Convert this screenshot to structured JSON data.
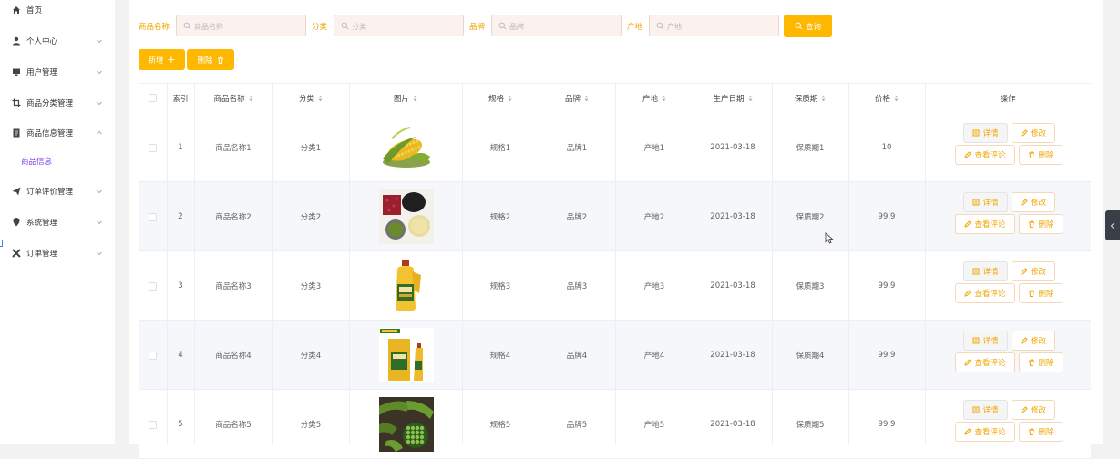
{
  "sidebar": {
    "items": [
      {
        "label": "首页",
        "icon": "home-icon",
        "has_arrow": false,
        "expanded": false
      },
      {
        "label": "个人中心",
        "icon": "user-icon",
        "has_arrow": true,
        "expanded": false
      },
      {
        "label": "用户管理",
        "icon": "monitor-icon",
        "has_arrow": true,
        "expanded": false
      },
      {
        "label": "商品分类管理",
        "icon": "crop-icon",
        "has_arrow": true,
        "expanded": false
      },
      {
        "label": "商品信息管理",
        "icon": "document-icon",
        "has_arrow": true,
        "expanded": true
      },
      {
        "label": "订单评价管理",
        "icon": "paper-plane-icon",
        "has_arrow": true,
        "expanded": false
      },
      {
        "label": "系统管理",
        "icon": "location-pin-icon",
        "has_arrow": true,
        "expanded": false
      },
      {
        "label": "订单管理",
        "icon": "tools-icon",
        "has_arrow": true,
        "expanded": false
      }
    ],
    "subitem": {
      "label": "商品信息"
    }
  },
  "search": {
    "fields": [
      {
        "label": "商品名称",
        "placeholder": "商品名称"
      },
      {
        "label": "分类",
        "placeholder": "分类"
      },
      {
        "label": "品牌",
        "placeholder": "品牌"
      },
      {
        "label": "产地",
        "placeholder": "产地"
      }
    ],
    "query_label": "查询"
  },
  "actions": {
    "add_label": "新增",
    "delete_label": "删除"
  },
  "table": {
    "columns": [
      "索引",
      "商品名称",
      "分类",
      "图片",
      "规格",
      "品牌",
      "产地",
      "生产日期",
      "保质期",
      "价格",
      "操作"
    ],
    "rows": [
      {
        "index": "1",
        "name": "商品名称1",
        "category": "分类1",
        "image": "corn",
        "spec": "规格1",
        "brand": "品牌1",
        "origin": "产地1",
        "date": "2021-03-18",
        "shelf": "保质期1",
        "price": "10"
      },
      {
        "index": "2",
        "name": "商品名称2",
        "category": "分类2",
        "image": "grains",
        "spec": "规格2",
        "brand": "品牌2",
        "origin": "产地2",
        "date": "2021-03-18",
        "shelf": "保质期2",
        "price": "99.9"
      },
      {
        "index": "3",
        "name": "商品名称3",
        "category": "分类3",
        "image": "oil-bottle",
        "spec": "规格3",
        "brand": "品牌3",
        "origin": "产地3",
        "date": "2021-03-18",
        "shelf": "保质期3",
        "price": "99.9"
      },
      {
        "index": "4",
        "name": "商品名称4",
        "category": "分类4",
        "image": "oil-set",
        "spec": "规格4",
        "brand": "品牌4",
        "origin": "产地4",
        "date": "2021-03-18",
        "shelf": "保质期4",
        "price": "99.9"
      },
      {
        "index": "5",
        "name": "商品名称5",
        "category": "分类5",
        "image": "peas",
        "spec": "规格5",
        "brand": "品牌5",
        "origin": "产地5",
        "date": "2021-03-18",
        "shelf": "保质期5",
        "price": "99.9"
      }
    ],
    "row_actions": {
      "detail": "详情",
      "edit": "修改",
      "review": "查看评论",
      "delete": "删除"
    }
  },
  "colors": {
    "accent": "#ffb800",
    "submenu_active": "#7c3aed",
    "stripe": "#f5f7fa"
  }
}
